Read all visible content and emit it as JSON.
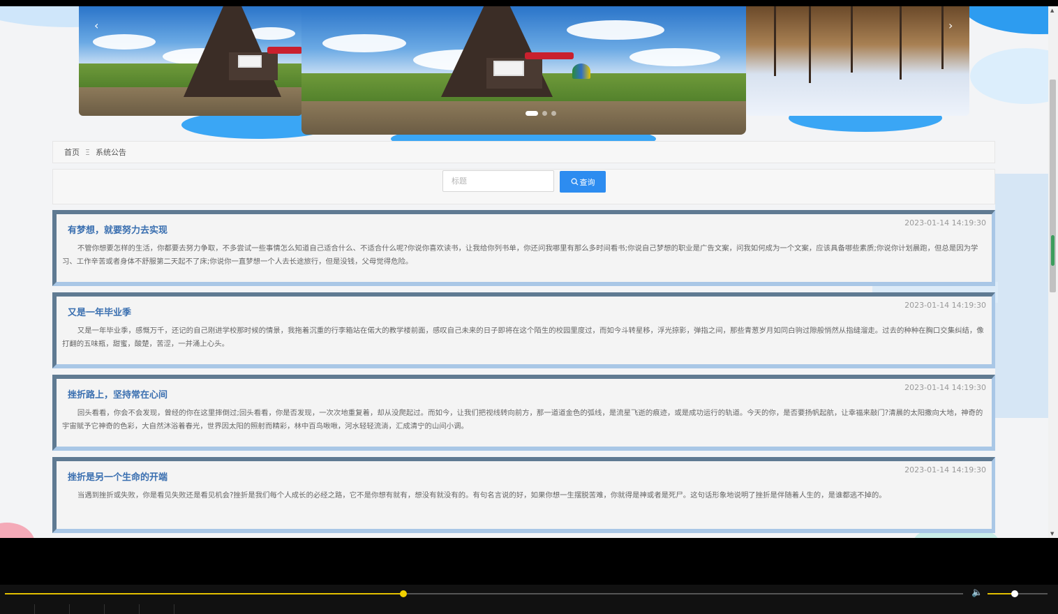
{
  "carousel": {
    "prev_icon": "‹",
    "next_icon": "›",
    "slide_count": 3,
    "active_index": 0
  },
  "breadcrumb": {
    "home": "首页",
    "separator": "Ξ",
    "current": "系统公告"
  },
  "search": {
    "placeholder": "标题",
    "value": "",
    "button_label": "查询",
    "button_icon": "search-icon"
  },
  "notices": [
    {
      "title": "有梦想，就要努力去实现",
      "time": "2023-01-14 14:19:30",
      "content": "不管你想要怎样的生活，你都要去努力争取，不多尝试一些事情怎么知道自己适合什么、不适合什么呢?你说你喜欢读书，让我给你列书单，你还问我哪里有那么多时间看书;你说自己梦想的职业是广告文案，问我如何成为一个文案，应该具备哪些素质;你说你计划晨跑，但总是因为学习、工作辛苦或者身体不舒服第二天起不了床;你说你一直梦想一个人去长途旅行，但是没钱，父母觉得危险。"
    },
    {
      "title": "又是一年毕业季",
      "time": "2023-01-14 14:19:30",
      "content": "又是一年毕业季，感慨万千，还记的自己刚进学校那时候的情景，我拖着沉重的行李箱站在偌大的教学楼前面，感叹自己未来的日子即将在这个陌生的校园里度过，而如今斗转星移，浮光掠影，弹指之间，那些青葱岁月如同白驹过隙般悄然从指缝溜走。过去的种种在胸口交集纠结，像打翻的五味瓶，甜蜜，酸楚，苦涩，一并涌上心头。"
    },
    {
      "title": "挫折路上，坚持常在心间",
      "time": "2023-01-14 14:19:30",
      "content": "回头看看，你会不会发现，曾经的你在这里摔倒过;回头看看，你是否发现，一次次地重复着，却从没爬起过。而如今，让我们把视线转向前方，那一道道金色的弧线，是流星飞逝的痕迹，或是成功运行的轨道。今天的你，是否要扬帆起航，让幸福来敲门?清晨的太阳撒向大地，神奇的宇宙赋予它神奇的色彩，大自然沐浴着春光，世界因太阳的照射而精彩，林中百鸟啾啾，河水轻轻流淌，汇成清宁的山间小调。"
    },
    {
      "title": "挫折是另一个生命的开端",
      "time": "2023-01-14 14:19:30",
      "content": "当遇到挫折或失败，你是看见失败还是看见机会?挫折是我们每个人成长的必经之路，它不是你想有就有，想没有就没有的。有句名言说的好，如果你想一生摆脱苦难，你就得是神或者是死尸。这句话形象地说明了挫折是伴随着人生的，是谁都逃不掉的。"
    }
  ],
  "player": {
    "progress": 0.416,
    "volume": 0.45
  },
  "colors": {
    "accent": "#2d8cf0",
    "title": "#3a6fb0",
    "card_border_dark": "#5f7a92",
    "card_border_light": "#a9c7e6",
    "progress": "#e2c000"
  }
}
